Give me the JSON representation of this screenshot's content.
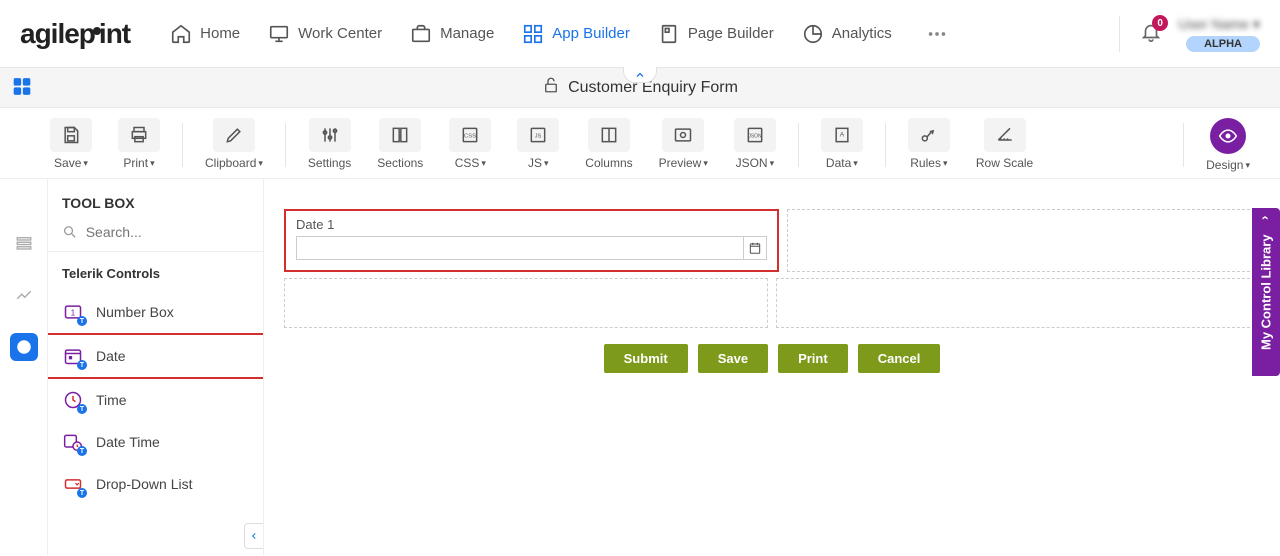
{
  "logo_text": "agilepoint",
  "nav": {
    "items": [
      {
        "label": "Home"
      },
      {
        "label": "Work Center"
      },
      {
        "label": "Manage"
      },
      {
        "label": "App Builder"
      },
      {
        "label": "Page Builder"
      },
      {
        "label": "Analytics"
      }
    ]
  },
  "notifications": {
    "count": "0"
  },
  "user": {
    "name": "User Name",
    "env_badge": "ALPHA"
  },
  "form_title": "Customer Enquiry Form",
  "toolbar": {
    "save": "Save",
    "print": "Print",
    "clipboard": "Clipboard",
    "settings": "Settings",
    "sections": "Sections",
    "css": "CSS",
    "js": "JS",
    "columns": "Columns",
    "preview": "Preview",
    "json": "JSON",
    "data": "Data",
    "rules": "Rules",
    "rowscale": "Row Scale",
    "design": "Design"
  },
  "toolbox": {
    "title": "TOOL BOX",
    "search_placeholder": "Search...",
    "section": "Telerik Controls",
    "controls": [
      "Number Box",
      "Date",
      "Time",
      "Date Time",
      "Drop-Down List"
    ]
  },
  "canvas": {
    "field_label": "Date 1",
    "buttons": {
      "submit": "Submit",
      "save": "Save",
      "print": "Print",
      "cancel": "Cancel"
    }
  },
  "library_tab": "My Control Library"
}
